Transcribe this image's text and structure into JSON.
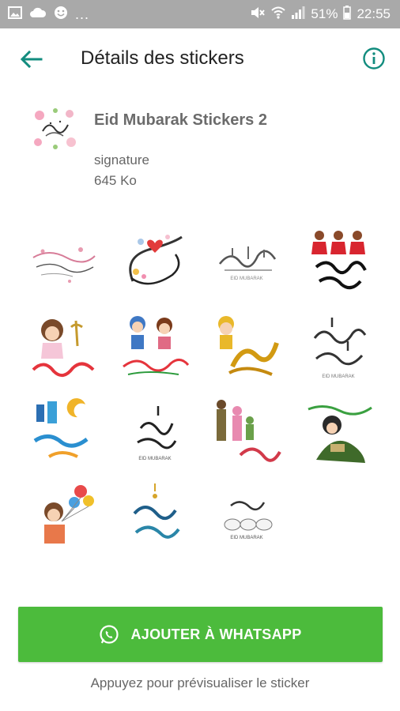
{
  "status_bar": {
    "left_icons": [
      "image-icon",
      "cloud-icon",
      "smiley-icon"
    ],
    "overflow": "...",
    "right_icons": [
      "mute-icon",
      "wifi-icon",
      "signal-icon"
    ],
    "battery_percent": "51%",
    "time": "22:55"
  },
  "header": {
    "title": "Détails des stickers",
    "back_icon": "arrow-back-icon",
    "info_icon": "info-icon",
    "accent_color": "#128c7e"
  },
  "pack": {
    "name": "Eid Mubarak Stickers 2",
    "author": "signature",
    "size": "645 Ko"
  },
  "stickers": [
    {
      "name": "sticker-floral-calligraphy"
    },
    {
      "name": "sticker-heart-calligraphy"
    },
    {
      "name": "sticker-eid-calligraphy-gray"
    },
    {
      "name": "sticker-girls-eid-mubarak"
    },
    {
      "name": "sticker-girl-eid-saeed"
    },
    {
      "name": "sticker-kids-eid"
    },
    {
      "name": "sticker-boy-gold-calligraphy"
    },
    {
      "name": "sticker-eid-mubarak-black"
    },
    {
      "name": "sticker-ramadan-mubarak-lanterns"
    },
    {
      "name": "sticker-eid-mubarak-minimal"
    },
    {
      "name": "sticker-family-calligraphy"
    },
    {
      "name": "sticker-woman-reading-green"
    },
    {
      "name": "sticker-boy-balloons"
    },
    {
      "name": "sticker-ramadan-kareem-blue"
    },
    {
      "name": "sticker-eid-sheep"
    }
  ],
  "cta": {
    "label": "AJOUTER À WHATSAPP",
    "icon": "whatsapp-icon",
    "color": "#4cbb3c"
  },
  "hint": "Appuyez pour prévisualiser le sticker"
}
